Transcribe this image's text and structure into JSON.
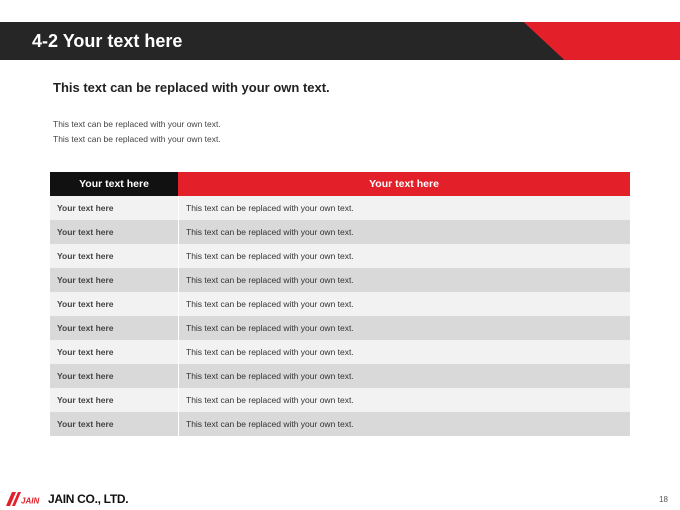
{
  "header": {
    "title": "4-2 Your text here"
  },
  "subtitle": "This text can be replaced with your own text.",
  "description": [
    "This text can be replaced with your own text.",
    "This text can be replaced with your own text."
  ],
  "table": {
    "headers": [
      "Your text here",
      "Your text here"
    ],
    "rows": [
      [
        "Your text here",
        "This text can be replaced with your own text."
      ],
      [
        "Your text here",
        "This text can be replaced with your own text."
      ],
      [
        "Your text here",
        "This text can be replaced with your own text."
      ],
      [
        "Your text here",
        "This text can be replaced with your own text."
      ],
      [
        "Your text here",
        "This text can be replaced with your own text."
      ],
      [
        "Your text here",
        "This text can be replaced with your own text."
      ],
      [
        "Your text here",
        "This text can be replaced with your own text."
      ],
      [
        "Your text here",
        "This text can be replaced with your own text."
      ],
      [
        "Your text here",
        "This text can be replaced with your own text."
      ],
      [
        "Your text here",
        "This text can be replaced with your own text."
      ]
    ]
  },
  "footer": {
    "logo_mark": "JAIN",
    "company": "JAIN CO., LTD.",
    "page_number": "18"
  },
  "colors": {
    "accent_red": "#e3202a",
    "header_dark": "#262626",
    "table_head_dark": "#111111",
    "row_light": "#f2f2f2",
    "row_dark": "#d9d9d9"
  }
}
